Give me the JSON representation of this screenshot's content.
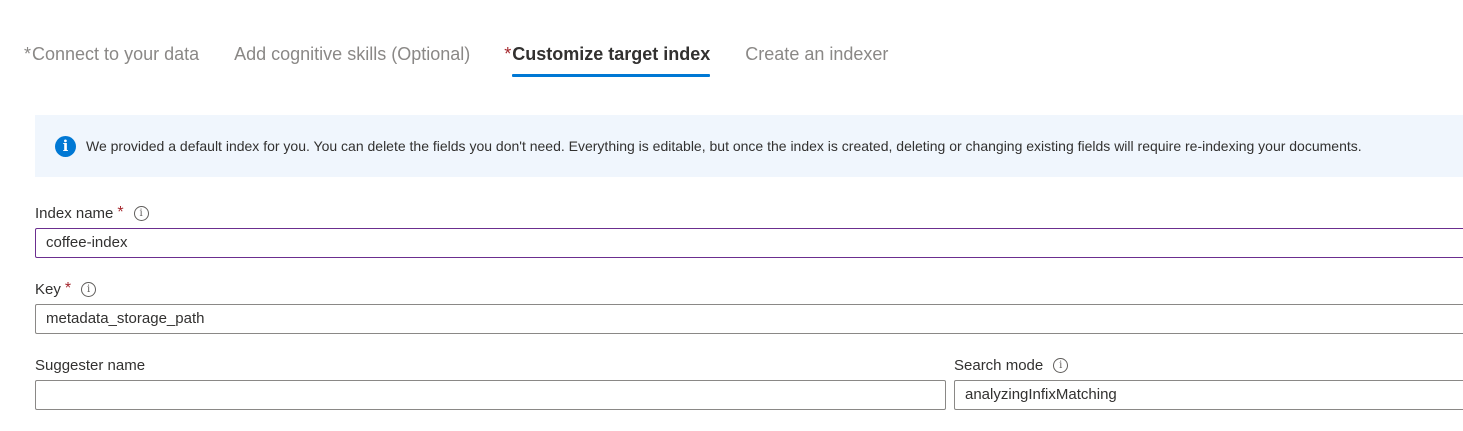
{
  "tabs": [
    {
      "required_mark": "*",
      "label": "Connect to your data",
      "active": false
    },
    {
      "required_mark": "",
      "label": "Add cognitive skills (Optional)",
      "active": false
    },
    {
      "required_mark": "*",
      "label": "Customize target index",
      "active": true
    },
    {
      "required_mark": "",
      "label": "Create an indexer",
      "active": false
    }
  ],
  "info_banner": {
    "icon": "info-icon",
    "icon_glyph": "i",
    "text": "We provided a default index for you. You can delete the fields you don't need. Everything is editable, but once the index is created, deleting or changing existing fields will require re-indexing your documents."
  },
  "fields": {
    "index_name": {
      "label": "Index name",
      "required": "*",
      "value": "coffee-index"
    },
    "key": {
      "label": "Key",
      "required": "*",
      "value": "metadata_storage_path"
    },
    "suggester_name": {
      "label": "Suggester name",
      "value": ""
    },
    "search_mode": {
      "label": "Search mode",
      "value": "analyzingInfixMatching"
    }
  },
  "colors": {
    "accent": "#0078d4",
    "required": "#a4262c",
    "banner_bg": "#f0f6fd",
    "focus_border": "#6b2e8f"
  }
}
